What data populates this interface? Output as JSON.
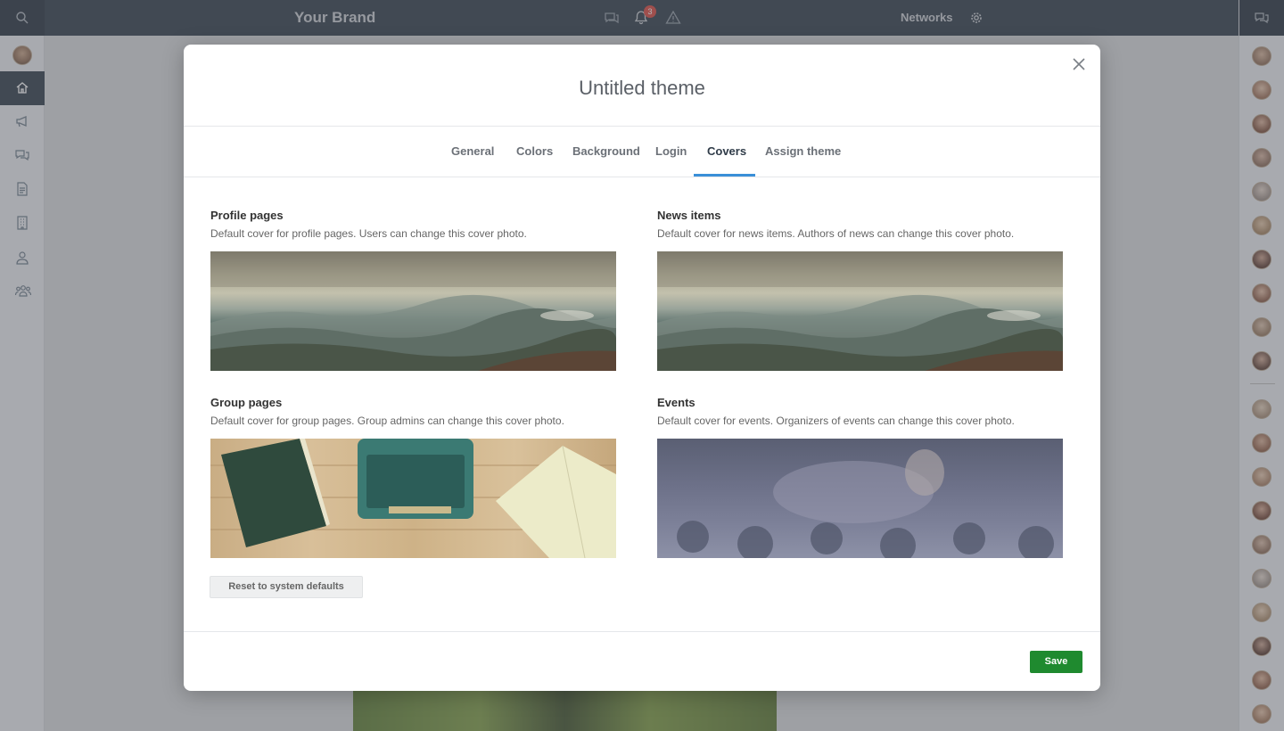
{
  "topbar": {
    "brand": "Your Brand",
    "notification_count": "3",
    "networks_label": "Networks",
    "icons": [
      "search-icon",
      "chat-icon",
      "bell-icon",
      "warning-icon",
      "gear-icon"
    ]
  },
  "sidebar": {
    "items": [
      {
        "name": "home",
        "icon": "home-icon"
      },
      {
        "name": "announcements",
        "icon": "megaphone-icon"
      },
      {
        "name": "conversations",
        "icon": "chat-icon"
      },
      {
        "name": "documents",
        "icon": "document-icon"
      },
      {
        "name": "organization",
        "icon": "building-icon"
      },
      {
        "name": "profile",
        "icon": "user-icon"
      },
      {
        "name": "groups",
        "icon": "group-icon"
      }
    ]
  },
  "modal": {
    "title": "Untitled theme",
    "tabs": [
      {
        "label": "General"
      },
      {
        "label": "Colors"
      },
      {
        "label": "Background"
      },
      {
        "label": "Login"
      },
      {
        "label": "Covers",
        "active": true
      },
      {
        "label": "Assign theme"
      }
    ],
    "sections": {
      "profile": {
        "title": "Profile pages",
        "description": "Default cover for profile pages. Users can change this cover photo."
      },
      "news": {
        "title": "News items",
        "description": "Default cover for news items. Authors of news can change this cover photo."
      },
      "group": {
        "title": "Group pages",
        "description": "Default cover for group pages. Group admins can change this cover photo."
      },
      "events": {
        "title": "Events",
        "description": "Default cover for events. Organizers of events can change this cover photo."
      }
    },
    "reset_label": "Reset to system defaults",
    "save_label": "Save"
  },
  "colors": {
    "topbar": "#2f3b48",
    "accent": "#3a8fd8",
    "save": "#1f8a2f",
    "badge": "#d9453d"
  }
}
